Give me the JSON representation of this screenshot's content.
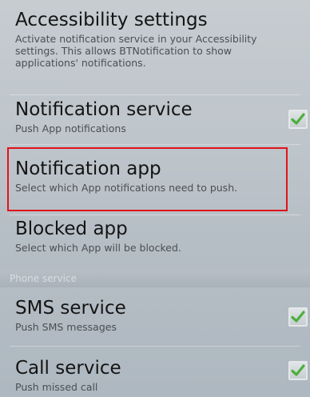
{
  "accessibility": {
    "title": "Accessibility settings",
    "summary": "Activate notification service in your Accessibility settings. This allows BTNotification to show applications' notifications."
  },
  "notification_service": {
    "title": "Notification service",
    "summary": "Push App notifications",
    "checked": true
  },
  "notification_app": {
    "title": "Notification app",
    "summary": "Select which App notifications need to push."
  },
  "blocked_app": {
    "title": "Blocked app",
    "summary": "Select which App will be blocked."
  },
  "phone_section": {
    "label": "Phone service"
  },
  "sms_service": {
    "title": "SMS service",
    "summary": "Push SMS messages",
    "checked": true
  },
  "call_service": {
    "title": "Call service",
    "summary": "Push missed call",
    "checked": true
  },
  "colors": {
    "highlight": "#e1141b",
    "check_green": "#4caf3c"
  },
  "icons": {
    "checkbox": "checkmark-icon"
  }
}
